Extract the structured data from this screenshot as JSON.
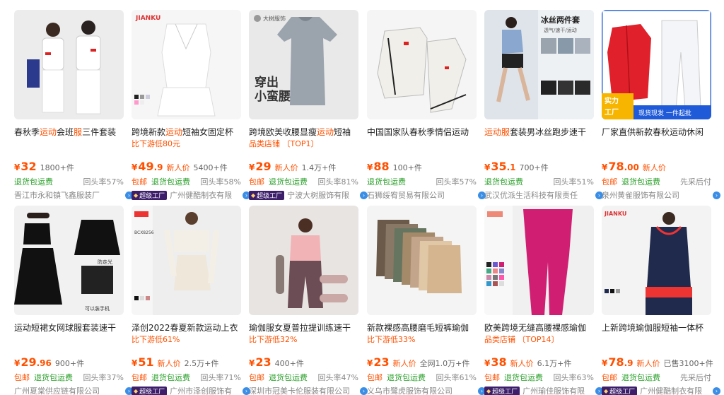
{
  "products": [
    {
      "title_pre": "春秋季",
      "title_hl": "运动",
      "title_post": "会班",
      "title_hl2": "服",
      "title_post2": "三件套装",
      "sub": "",
      "price_int": "32",
      "price_dec": "",
      "new_price": "",
      "sold": "1800+件",
      "tag_baoyou": "",
      "tag_return": "退货包运费",
      "repeat": "回头率57%",
      "badge": "",
      "shop": "晋江市永和镇飞鑫服装厂",
      "thumb": "couple",
      "bg": "#ececec"
    },
    {
      "title_pre": "跨境新款",
      "title_hl": "运动",
      "title_post": "短袖女固定杯",
      "title_hl2": "",
      "title_post2": "",
      "sub": "比下游低80元",
      "price_int": "49",
      "price_dec": ".9",
      "new_price": "新人价",
      "sold": "5400+件",
      "tag_baoyou": "包邮",
      "tag_return": "退货包运费",
      "repeat": "回头率58%",
      "badge": "超级工厂",
      "shop": "广州健酷制衣有限",
      "thumb": "whitetank",
      "bg": "#f2f2f2"
    },
    {
      "title_pre": "跨境欧美收腰显瘦",
      "title_hl": "运动",
      "title_post": "短袖",
      "title_hl2": "",
      "title_post2": "",
      "sub": "品类店铺",
      "sub_rank": "TOP1",
      "price_int": "29",
      "price_dec": "",
      "new_price": "新人价",
      "sold": "1.4万+件",
      "tag_baoyou": "包邮",
      "tag_return": "退货包运费",
      "repeat": "回头率81%",
      "badge": "超级工厂",
      "shop": "宁波大树服饰有限",
      "thumb": "greytee",
      "bg": "#e9e9e9"
    },
    {
      "title_pre": "中国国家队春秋季情侣运动",
      "title_hl": "",
      "title_post": "",
      "title_hl2": "",
      "title_post2": "",
      "sub": "",
      "price_int": "88",
      "price_dec": "",
      "new_price": "",
      "sold": "100+件",
      "tag_baoyou": "",
      "tag_return": "退货包运费",
      "repeat": "回头率57%",
      "badge": "",
      "shop": "石狮绥宥贸易有限公司",
      "thumb": "jacket",
      "bg": "#f5f5f5"
    },
    {
      "title_pre": "",
      "title_hl": "运动服",
      "title_post": "套装男冰丝跑步速干",
      "title_hl2": "",
      "title_post2": "",
      "sub": "",
      "price_int": "35",
      "price_dec": ".1",
      "new_price": "",
      "sold": "700+件",
      "tag_baoyou": "",
      "tag_return": "退货包运费",
      "repeat": "回头率51%",
      "badge": "",
      "shop": "武汉优派生活科技有限责任",
      "thumb": "runner",
      "bg": "#eef0f3",
      "thumb_text": "冰丝两件套",
      "thumb_text2": "透气/速干/运动"
    },
    {
      "title_pre": "厂家直供新款春秋运动休闲",
      "title_hl": "",
      "title_post": "",
      "title_hl2": "",
      "title_post2": "",
      "sub": "",
      "price_int": "78",
      "price_dec": ".00",
      "new_price": "新人价",
      "sold": "",
      "tag_baoyou": "包邮",
      "tag_return": "退货包运费",
      "repeat": "先采后付",
      "badge": "",
      "shop": "泉州黄雀服饰有限公司",
      "thumb": "redjacket",
      "bg": "#f3f3f3",
      "thumb_text": "实力工厂",
      "thumb_text2": "现货现发 一件起批"
    },
    {
      "title_pre": "运动短裙女网球服套装速干",
      "title_hl": "",
      "title_post": "",
      "title_hl2": "",
      "title_post2": "",
      "sub": "",
      "price_int": "29",
      "price_dec": ".96",
      "new_price": "",
      "sold": "900+件",
      "tag_baoyou": "包邮",
      "tag_return": "退货包运费",
      "repeat": "回头率37%",
      "badge": "",
      "shop": "广州夏棠供应链有限公司",
      "thumb": "skirt",
      "bg": "#f1f1f1",
      "thumb_text": "防走光",
      "thumb_text2": "可以装手机"
    },
    {
      "title_pre": "泽创2022春夏新款运动上衣",
      "title_hl": "",
      "title_post": "",
      "title_hl2": "",
      "title_post2": "",
      "sub": "比下游低61%",
      "price_int": "51",
      "price_dec": "",
      "new_price": "新人价",
      "sold": "2.5万+件",
      "tag_baoyou": "包邮",
      "tag_return": "退货包运费",
      "repeat": "回头率71%",
      "badge": "超级工厂",
      "shop": "广州市泽创服饰有",
      "thumb": "creamset",
      "bg": "#eeeeee"
    },
    {
      "title_pre": "瑜伽服女夏普拉提训练速干",
      "title_hl": "",
      "title_post": "",
      "title_hl2": "",
      "title_post2": "",
      "sub": "比下游低32%",
      "price_int": "23",
      "price_dec": "",
      "new_price": "",
      "sold": "400+件",
      "tag_baoyou": "包邮",
      "tag_return": "退货包运费",
      "repeat": "回头率47%",
      "badge": "",
      "shop": "深圳市冠美卡伦服装有限公司",
      "thumb": "yoga",
      "bg": "#e8e4e1"
    },
    {
      "title_pre": "新款裸感高腰磨毛短裤瑜伽",
      "title_hl": "",
      "title_post": "",
      "title_hl2": "",
      "title_post2": "",
      "sub": "比下游低33%",
      "price_int": "23",
      "price_dec": "",
      "new_price": "新人价",
      "sold": "全网1.0万+件",
      "tag_baoyou": "包邮",
      "tag_return": "退货包运费",
      "repeat": "回头率61%",
      "badge": "",
      "shop": "义乌市鹭虎服饰有限公司",
      "thumb": "shorts",
      "bg": "#f4f4f4"
    },
    {
      "title_pre": "欧美跨境无缝高腰裸感瑜伽",
      "title_hl": "",
      "title_post": "",
      "title_hl2": "",
      "title_post2": "",
      "sub": "品类店铺",
      "sub_rank": "TOP14",
      "price_int": "38",
      "price_dec": "",
      "new_price": "新人价",
      "sold": "6.1万+件",
      "tag_baoyou": "包邮",
      "tag_return": "退货包运费",
      "repeat": "回头率63%",
      "badge": "超级工厂",
      "shop": "广州瑜佳服饰有限",
      "thumb": "leggings",
      "bg": "#f0f0f0"
    },
    {
      "title_pre": "上新跨境瑜伽服短袖一体杯",
      "title_hl": "",
      "title_post": "",
      "title_hl2": "",
      "title_post2": "",
      "sub": "",
      "price_int": "78",
      "price_dec": ".9",
      "new_price": "新人价",
      "sold": "已售3100+件",
      "tag_baoyou": "包邮",
      "tag_return": "退货包运费",
      "repeat": "先采后付",
      "badge": "超级工厂",
      "shop": "广州健酷制衣有限",
      "thumb": "navytank",
      "bg": "#f3f3f3"
    }
  ],
  "currency": "¥",
  "brand_tag_1": "JIANKU",
  "brand_tag_2": "大树服饰",
  "thumb_big_text": "穿出",
  "thumb_big_text2": "小蛮腰",
  "icons": {
    "info": "info-icon",
    "badge": "diamond-icon"
  }
}
